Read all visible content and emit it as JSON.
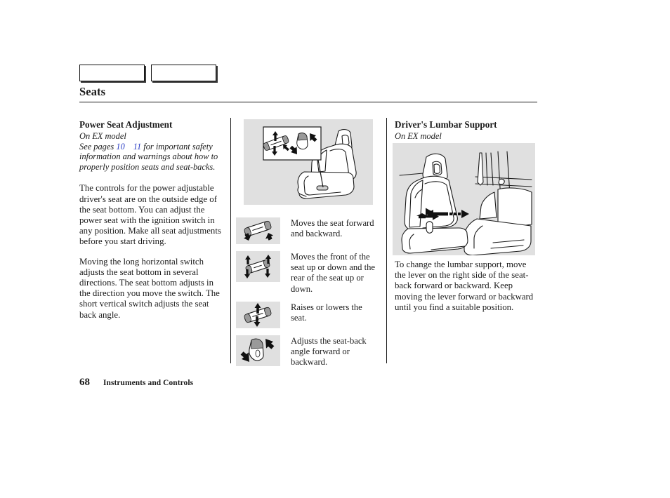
{
  "page": {
    "title": "Seats",
    "footer_page_number": "68",
    "footer_section": "Instruments and Controls"
  },
  "header_tabs": [
    {
      "label": ""
    },
    {
      "label": ""
    }
  ],
  "left_column": {
    "section_title": "Power Seat Adjustment",
    "subtitle": "On EX model",
    "cross_reference": {
      "prefix": "See pages",
      "page_a": "10",
      "page_b": "11",
      "suffix": "for important safety information and warnings about how to properly position seats and seat-backs.",
      "link_color": "#2b3ec4"
    },
    "paragraphs": [
      "The controls for the power adjustable driver's seat are on the outside edge of the seat bottom. You can adjust the power seat with the ignition switch in any position. Make all seat adjustments before you start driving.",
      "Moving the long horizontal switch adjusts the seat bottom in several directions. The seat bottom adjusts in the direction you move the switch. The short vertical switch adjusts the seat back angle."
    ]
  },
  "middle_column": {
    "illustration_name": "power-seat-switch-location-illustration",
    "switch_rows": [
      {
        "icon": "horizontal-switch-front-back-icon",
        "description": "Moves the seat forward and backward."
      },
      {
        "icon": "horizontal-switch-tilt-icon",
        "description": "Moves the front of the seat up or down and the rear of the seat up or down."
      },
      {
        "icon": "horizontal-switch-raise-lower-icon",
        "description": "Raises or lowers the seat."
      },
      {
        "icon": "vertical-switch-recline-icon",
        "description": "Adjusts the seat-back angle forward or backward."
      }
    ]
  },
  "right_column": {
    "section_title": "Driver's Lumbar Support",
    "subtitle": "On EX model",
    "illustration_name": "lumbar-support-lever-illustration",
    "paragraphs": [
      "To change the lumbar support, move the lever on the right side of the seat-back forward or backward. Keep moving the lever forward or backward until you find a suitable position."
    ]
  },
  "colors": {
    "illustration_background": "#e0e0e0",
    "text": "#1a1a1a",
    "link": "#2b3ec4"
  }
}
